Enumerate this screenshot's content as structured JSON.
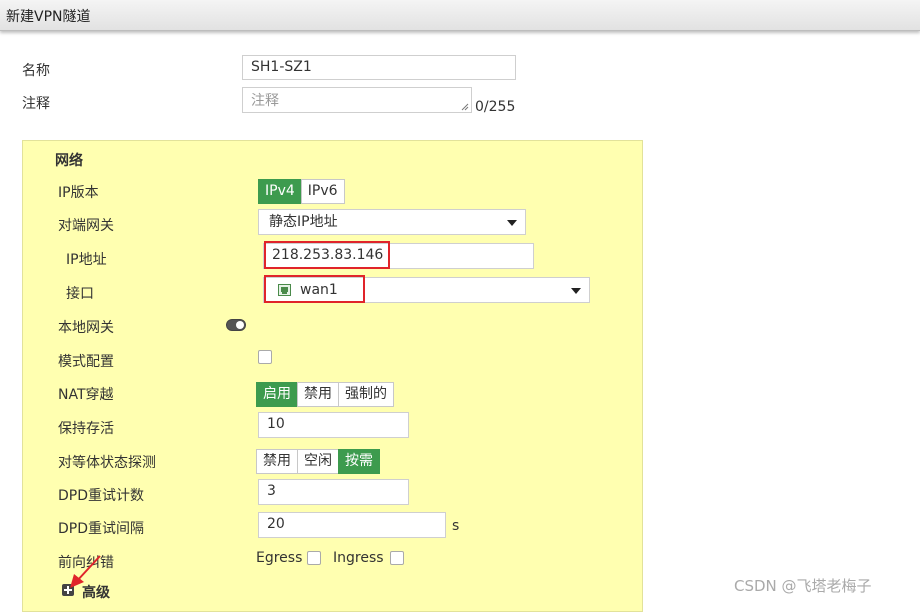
{
  "window": {
    "title": "新建VPN隧道"
  },
  "form": {
    "name_label": "名称",
    "name_value": "SH1-SZ1",
    "comment_label": "注释",
    "comment_placeholder": "注释",
    "comment_counter": "0/255"
  },
  "network": {
    "section_title": "网络",
    "ip_version_label": "IP版本",
    "ip_version_options": [
      "IPv4",
      "IPv6"
    ],
    "ip_version_selected": "IPv4",
    "remote_gateway_label": "对端网关",
    "remote_gateway_value": "静态IP地址",
    "ip_address_label": "IP地址",
    "ip_address_value": "218.253.83.146",
    "interface_label": "接口",
    "interface_value": "wan1",
    "local_gateway_label": "本地网关",
    "mode_config_label": "模式配置",
    "nat_traversal_label": "NAT穿越",
    "nat_traversal_options": [
      "启用",
      "禁用",
      "强制的"
    ],
    "nat_traversal_selected": "启用",
    "keepalive_label": "保持存活",
    "keepalive_value": "10",
    "dpd_label": "对等体状态探测",
    "dpd_options": [
      "禁用",
      "空闲",
      "按需"
    ],
    "dpd_selected": "按需",
    "dpd_retry_count_label": "DPD重试计数",
    "dpd_retry_count_value": "3",
    "dpd_retry_interval_label": "DPD重试间隔",
    "dpd_retry_interval_value": "20",
    "dpd_retry_interval_unit": "s",
    "fec_label": "前向纠错",
    "fec_egress_label": "Egress",
    "fec_ingress_label": "Ingress",
    "advanced_label": "高级"
  },
  "watermark": "CSDN @飞塔老梅子",
  "colors": {
    "panel_bg": "#ffffb0",
    "accent_green": "#3d9b4e",
    "highlight_red": "#e0242a"
  }
}
